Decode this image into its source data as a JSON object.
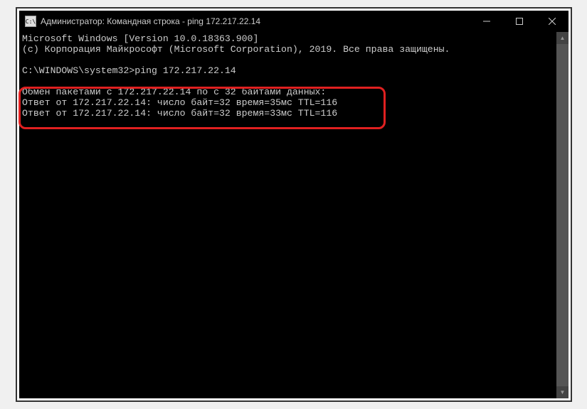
{
  "titlebar": {
    "icon_text": "C:\\",
    "title": "Администратор: Командная строка - ping  172.217.22.14"
  },
  "console": {
    "line1": "Microsoft Windows [Version 10.0.18363.900]",
    "line2": "(c) Корпорация Майкрософт (Microsoft Corporation), 2019. Все права защищены.",
    "blank1": "",
    "prompt": "C:\\WINDOWS\\system32>ping 172.217.22.14",
    "blank2": "",
    "exchange": "Обмен пакетами с 172.217.22.14 по с 32 байтами данных:",
    "reply1": "Ответ от 172.217.22.14: число байт=32 время=35мс TTL=116",
    "reply2": "Ответ от 172.217.22.14: число байт=32 время=33мс TTL=116"
  },
  "ping": {
    "target_ip": "172.217.22.14",
    "packet_bytes": 32,
    "replies": [
      {
        "from": "172.217.22.14",
        "bytes": 32,
        "time_ms": 35,
        "ttl": 116
      },
      {
        "from": "172.217.22.14",
        "bytes": 32,
        "time_ms": 33,
        "ttl": 116
      }
    ]
  }
}
